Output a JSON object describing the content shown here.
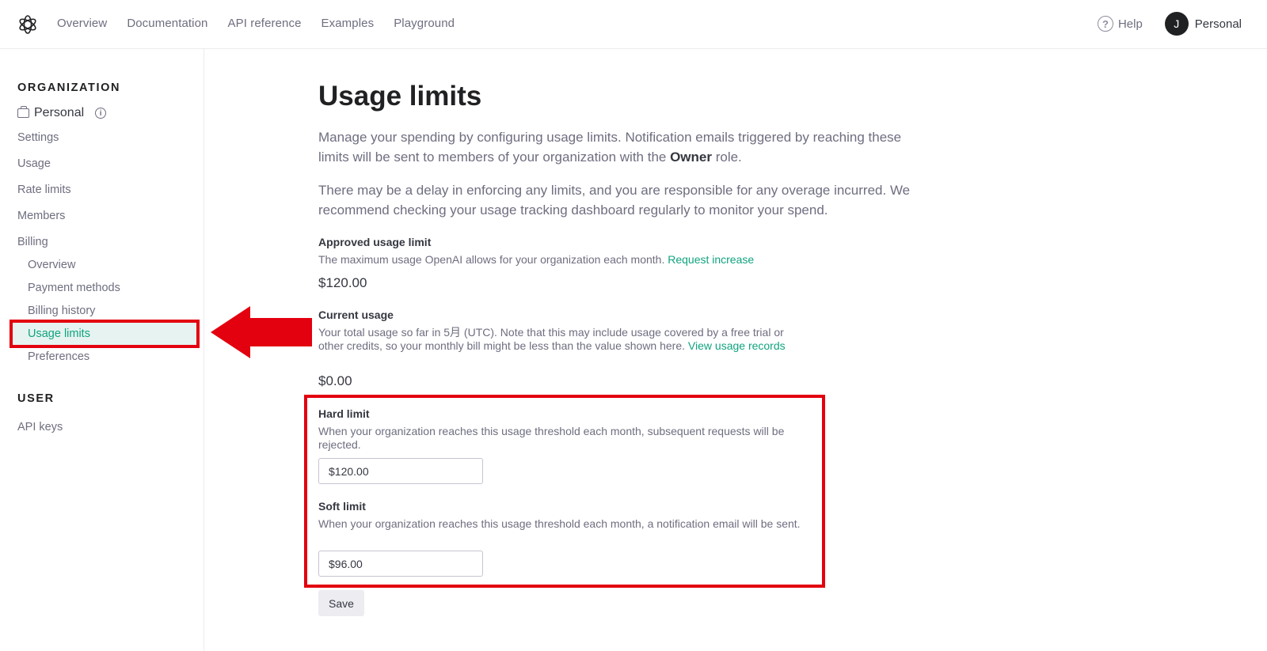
{
  "nav": {
    "links": [
      "Overview",
      "Documentation",
      "API reference",
      "Examples",
      "Playground"
    ],
    "help_label": "Help",
    "avatar_initial": "J",
    "account_name": "Personal"
  },
  "sidebar": {
    "org_heading": "ORGANIZATION",
    "org_name": "Personal",
    "items": [
      "Settings",
      "Usage",
      "Rate limits",
      "Members",
      "Billing"
    ],
    "billing_items": [
      "Overview",
      "Payment methods",
      "Billing history",
      "Usage limits",
      "Preferences"
    ],
    "active_item": "Usage limits",
    "user_heading": "USER",
    "user_items": [
      "API keys"
    ]
  },
  "main": {
    "title": "Usage limits",
    "intro_1a": "Manage your spending by configuring usage limits. Notification emails triggered by reaching these limits will be sent to members of your organization with the ",
    "intro_1_bold": "Owner",
    "intro_1b": " role.",
    "intro_2": "There may be a delay in enforcing any limits, and you are responsible for any overage incurred. We recommend checking your usage tracking dashboard regularly to monitor your spend.",
    "approved": {
      "label": "Approved usage limit",
      "desc": "The maximum usage OpenAI allows for your organization each month. ",
      "link": "Request increase",
      "value": "$120.00"
    },
    "current": {
      "label": "Current usage",
      "desc": "Your total usage so far in 5月 (UTC). Note that this may include usage covered by a free trial or other credits, so your monthly bill might be less than the value shown here. ",
      "link": "View usage records",
      "value": "$0.00"
    },
    "hard": {
      "label": "Hard limit",
      "desc": "When your organization reaches this usage threshold each month, subsequent requests will be rejected.",
      "value": "$120.00"
    },
    "soft": {
      "label": "Soft limit",
      "desc": "When your organization reaches this usage threshold each month, a notification email will be sent.",
      "value": "$96.00"
    },
    "save_label": "Save"
  },
  "colors": {
    "accent": "#10a37f",
    "annotation_red": "#e3000f"
  }
}
